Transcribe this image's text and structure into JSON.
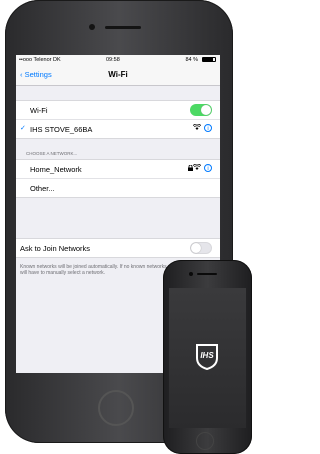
{
  "status_bar": {
    "carrier": "••ooo Telenor DK",
    "time": "09:58",
    "battery": "84 %"
  },
  "nav": {
    "back_label": "Settings",
    "title": "Wi-Fi"
  },
  "wifi": {
    "label": "Wi-Fi",
    "enabled": true,
    "connected_network": "IHS STOVE_66BA"
  },
  "choose_network": {
    "header": "CHOOSE A NETWORK...",
    "networks": [
      "Home_Network"
    ],
    "other_label": "Other..."
  },
  "ask_to_join": {
    "label": "Ask to Join Networks",
    "enabled": false,
    "description": "Known networks will be joined automatically. If no known networks are available, you will have to manually select a network."
  },
  "small_device": {
    "logo_text": "IHS"
  },
  "colors": {
    "accent": "#007aff",
    "toggle_on": "#4cd964",
    "toggle_off": "#e5e5ea",
    "background": "#efeff4"
  },
  "icons": {
    "back": "chevron-left-icon",
    "check": "checkmark-icon",
    "info": "info-circle-icon",
    "lock": "lock-icon",
    "wifi": "wifi-icon",
    "logo": "ihs-logo"
  }
}
